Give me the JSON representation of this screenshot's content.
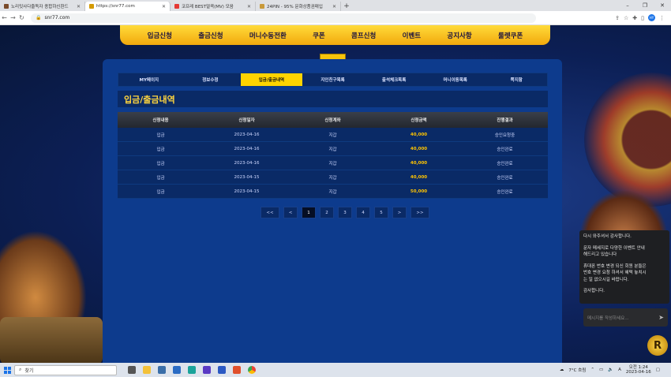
{
  "browser": {
    "tabs": [
      {
        "label": "노리밋사다줄독자 종합하신환드",
        "active": false,
        "fav_color": "#7a4b2a"
      },
      {
        "label": "https://snr77.com",
        "active": true,
        "fav_color": "#d49a00"
      },
      {
        "label": "코프레 BEST얼콕(MV) 모음",
        "active": false,
        "fav_color": "#e53935"
      },
      {
        "label": "24PIN - 95% 문화상품권매입",
        "active": false,
        "fav_color": "#c99a3a"
      }
    ],
    "new_tab": "+",
    "url": "snr77.com",
    "profile_initials": "HY"
  },
  "site": {
    "top_menu": [
      "입금신청",
      "출금신청",
      "머니수동전환",
      "쿠폰",
      "콤프신청",
      "이벤트",
      "공지사항",
      "룰렛쿠폰"
    ],
    "sub_tabs": [
      {
        "label": "MY페이지",
        "active": false
      },
      {
        "label": "정보수정",
        "active": false
      },
      {
        "label": "입금/출금내역",
        "active": true
      },
      {
        "label": "지인친구목록",
        "active": false
      },
      {
        "label": "출석체크목록",
        "active": false
      },
      {
        "label": "머니이동목록",
        "active": false
      },
      {
        "label": "쪽지함",
        "active": false
      }
    ],
    "page_title": "입금/출금내역",
    "table": {
      "headers": [
        "신청내용",
        "신청일자",
        "신청계좌",
        "신청금액",
        "진행결과"
      ],
      "rows": [
        [
          "입금",
          "2023-04-16",
          "지갑",
          "40,000",
          "승인요청중"
        ],
        [
          "입금",
          "2023-04-16",
          "지갑",
          "40,000",
          "승인완료"
        ],
        [
          "입금",
          "2023-04-16",
          "지갑",
          "40,000",
          "승인완료"
        ],
        [
          "입금",
          "2023-04-15",
          "지갑",
          "40,000",
          "승인완료"
        ],
        [
          "입금",
          "2023-04-15",
          "지갑",
          "50,000",
          "승인완료"
        ]
      ]
    },
    "pager": {
      "first": "<<",
      "prev": "<",
      "pages": [
        "1",
        "2",
        "3",
        "4",
        "5"
      ],
      "current": "1",
      "next": ">",
      "last": ">>"
    }
  },
  "chat": {
    "messages": [
      "다시 와주셔서 감사합니다.",
      "",
      "문자 메세지로 다양한 이벤트 안내",
      "해드리고 있습니다",
      "",
      "휴대폰 번호 변경 되신 회원 분들은",
      "번호 변경 요청 하셔서 혜택 놓치시",
      "는 일 없으시길 바랍니다.",
      "",
      "감사합니다."
    ],
    "input_placeholder": "메시지를 작성하세요..."
  },
  "taskbar": {
    "search_label": "찾기",
    "weather": "7°C 흐림",
    "ime": "A",
    "time": "오전 1:24",
    "date": "2023-04-16"
  },
  "colors": {
    "accent_yellow": "#ffd400",
    "amount_gold": "#ffc400",
    "panel_blue": "#0d3b8d"
  }
}
